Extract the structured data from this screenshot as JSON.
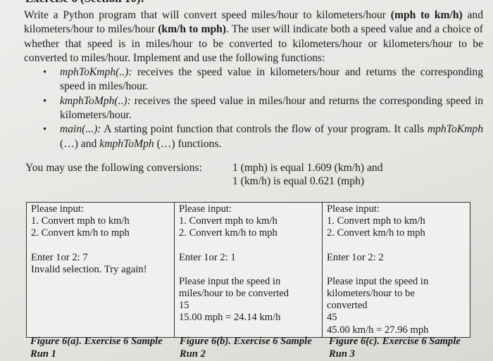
{
  "heading": "Exercise 6 (Section 10):",
  "intro": {
    "t1": "Write a Python program that will convert speed miles/hour to kilometers/hour ",
    "b1": "(mph to km/h)",
    "t2": " and kilometers/hour to miles/hour ",
    "b2": "(km/h to mph)",
    "t3": ". The user will indicate both a speed value and a choice of whether that speed is in miles/hour to be converted to kilometers/hour or kilometers/hour to be converted to miles/hour. Implement and use the following functions:"
  },
  "functions": [
    {
      "name": "mphToKmph(..):",
      "desc": " receives the speed value in kilometers/hour and returns the corresponding speed in miles/hour."
    },
    {
      "name": "kmphToMph(..):",
      "desc": " receives the speed value in miles/hour and returns the corresponding speed in kilometers/hour."
    },
    {
      "name": "main(...):",
      "desc": " A starting point function that controls the flow of your program. It calls ",
      "f1": "mphToKmph",
      "m": " (…) and ",
      "f2": "kmphToMph",
      "e": " (…) functions."
    }
  ],
  "conversions": {
    "label": "You may use the following conversions:",
    "line1": "1 (mph) is equal 1.609 (km/h) and",
    "line2": "1 (km/h) is equal 0.621 (mph)"
  },
  "runs": [
    {
      "menu": [
        "Please input:",
        "1. Convert mph to km/h",
        "2. Convert km/h to mph"
      ],
      "prompt": "Enter 1or 2: 7",
      "output": [
        "Invalid selection. Try again!"
      ],
      "caption": "Figure 6(a). Exercise 6 Sample Run 1"
    },
    {
      "menu": [
        "Please input:",
        "1. Convert mph to km/h",
        "2. Convert km/h to mph"
      ],
      "prompt": "Enter 1or 2: 1",
      "output": [
        "Please input the speed in miles/hour to be converted",
        "15",
        "15.00 mph = 24.14 km/h"
      ],
      "caption": "Figure 6(b). Exercise 6 Sample Run 2"
    },
    {
      "menu": [
        "Please input:",
        "1. Convert mph to km/h",
        "2. Convert km/h to mph"
      ],
      "prompt": "Enter 1or 2: 2",
      "output": [
        "Please input the speed in kilometers/hour to be converted",
        "45",
        "45.00 km/h = 27.96 mph"
      ],
      "caption": "Figure 6(c). Exercise 6 Sample Run 3"
    }
  ]
}
